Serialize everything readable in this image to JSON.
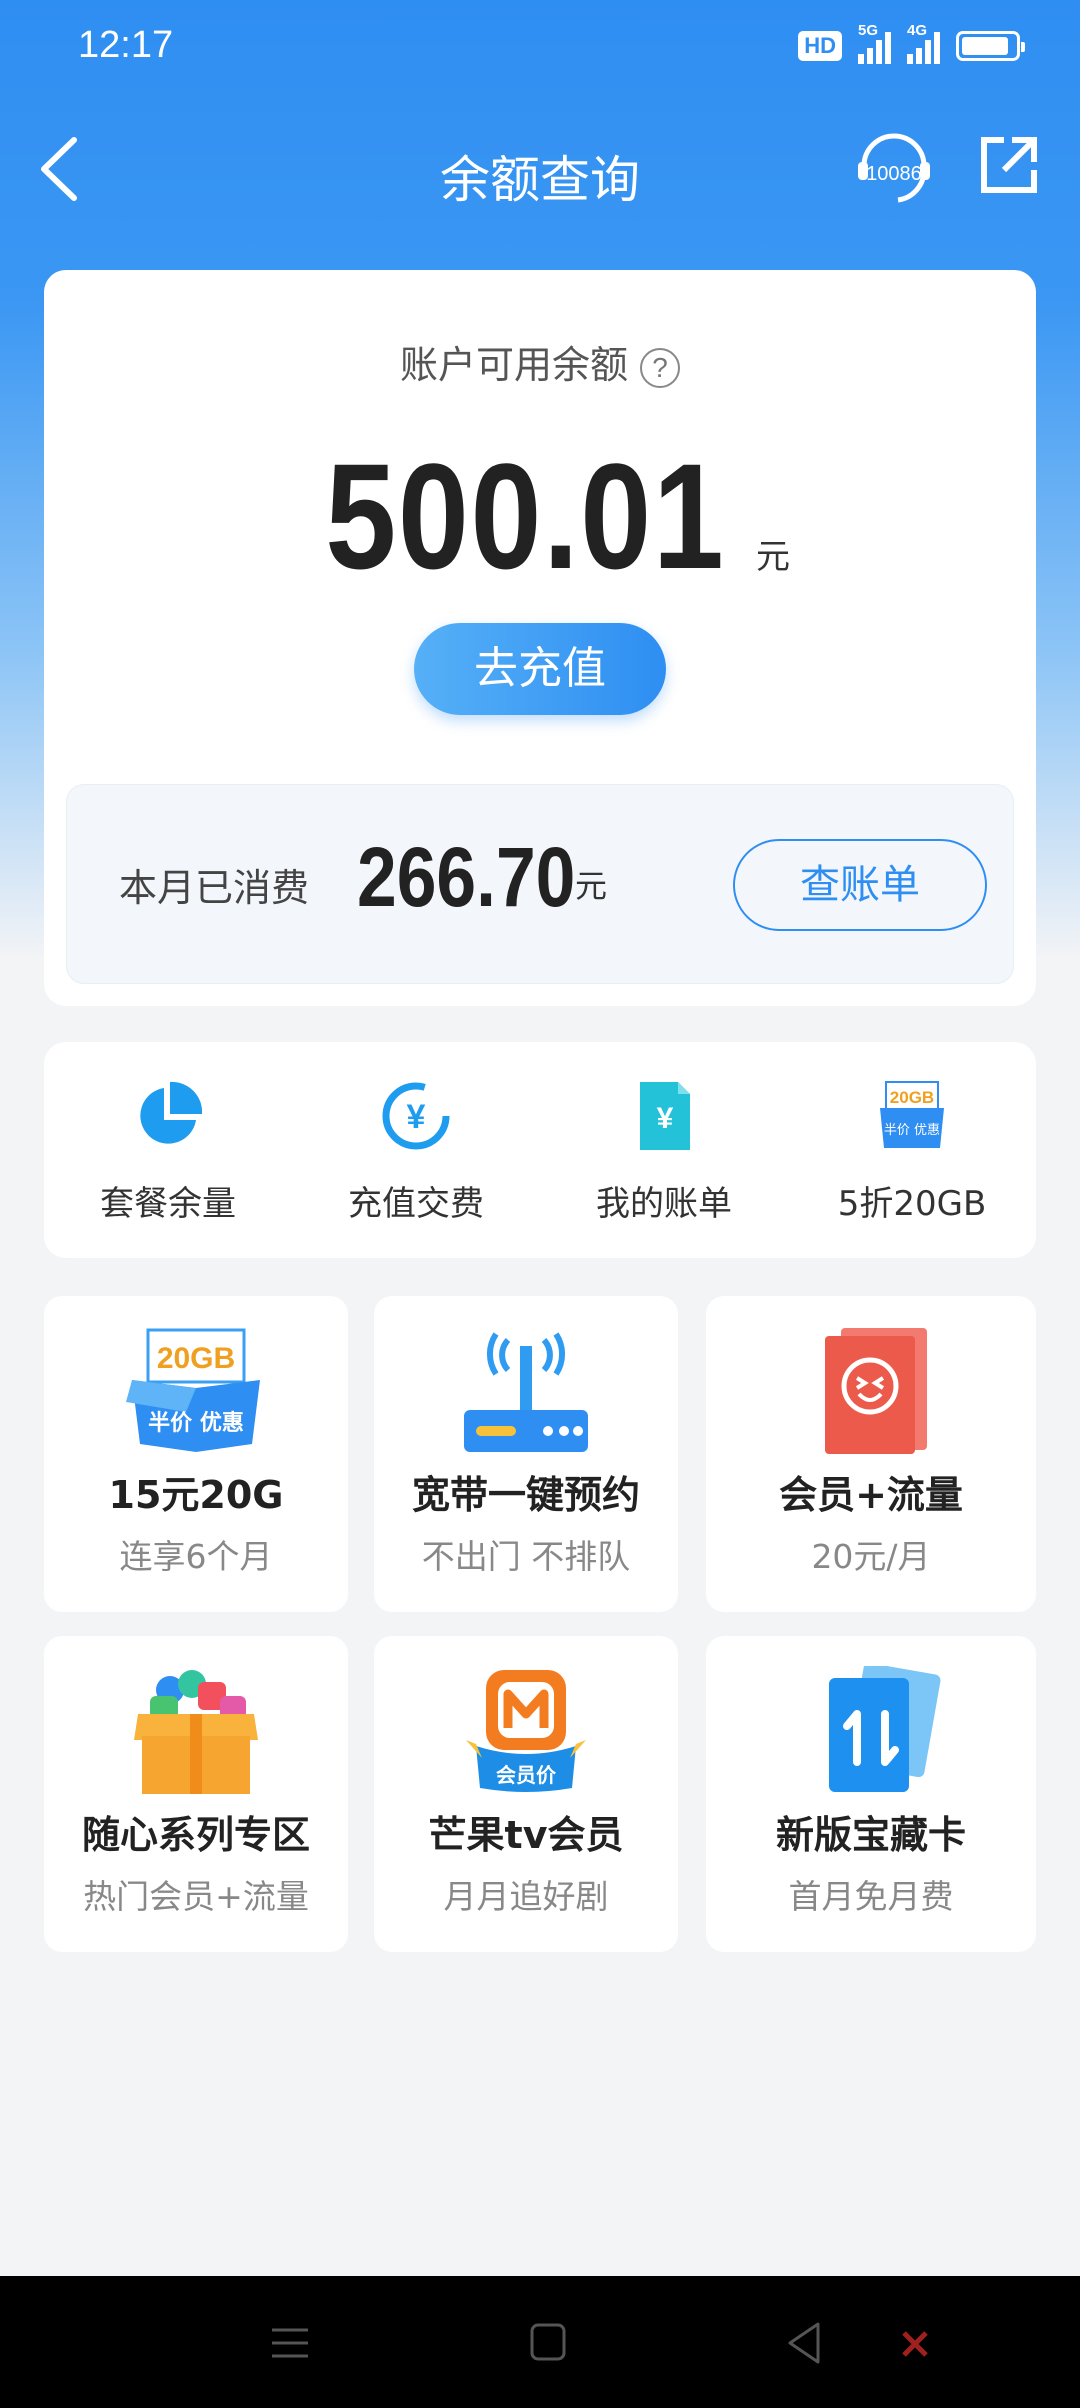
{
  "status_bar": {
    "time": "12:17",
    "hd_label": "HD",
    "sig1_label": "5G",
    "sig2_label": "4G"
  },
  "nav": {
    "title": "余额查询",
    "service_label": "10086"
  },
  "balance": {
    "label": "账户可用余额",
    "help": "?",
    "amount": "500.01",
    "unit": "元",
    "recharge_label": "去充值"
  },
  "consumption": {
    "label": "本月已消费",
    "amount": "266.70",
    "unit": "元",
    "bill_button": "查账单"
  },
  "quick_actions": [
    {
      "label": "套餐余量",
      "icon": "pie-chart-icon"
    },
    {
      "label": "充值交费",
      "icon": "yuan-coin-icon"
    },
    {
      "label": "我的账单",
      "icon": "bill-document-icon"
    },
    {
      "label": "5折20GB",
      "icon": "data-box-icon"
    }
  ],
  "promos": [
    {
      "title": "15元20G",
      "subtitle": "连享6个月",
      "icon": "data-box-icon",
      "icon_text_top": "20GB",
      "icon_text_bottom": "半价 优惠"
    },
    {
      "title": "宽带一键预约",
      "subtitle": "不出门 不排队",
      "icon": "router-icon"
    },
    {
      "title": "会员+流量",
      "subtitle": "20元/月",
      "icon": "member-card-icon"
    },
    {
      "title": "随心系列专区",
      "subtitle": "热门会员+流量",
      "icon": "gift-box-icon"
    },
    {
      "title": "芒果tv会员",
      "subtitle": "月月追好剧",
      "icon": "mango-tv-icon",
      "icon_text_bottom": "会员价"
    },
    {
      "title": "新版宝藏卡",
      "subtitle": "首月免月费",
      "icon": "treasure-card-icon"
    }
  ],
  "colors": {
    "primary": "#2f8ef2",
    "header_gradient_top": "#2f8ef2",
    "card_bg": "#ffffff",
    "page_bg": "#f3f4f6",
    "promo_red": "#f0584a",
    "promo_orange": "#f7a531"
  }
}
